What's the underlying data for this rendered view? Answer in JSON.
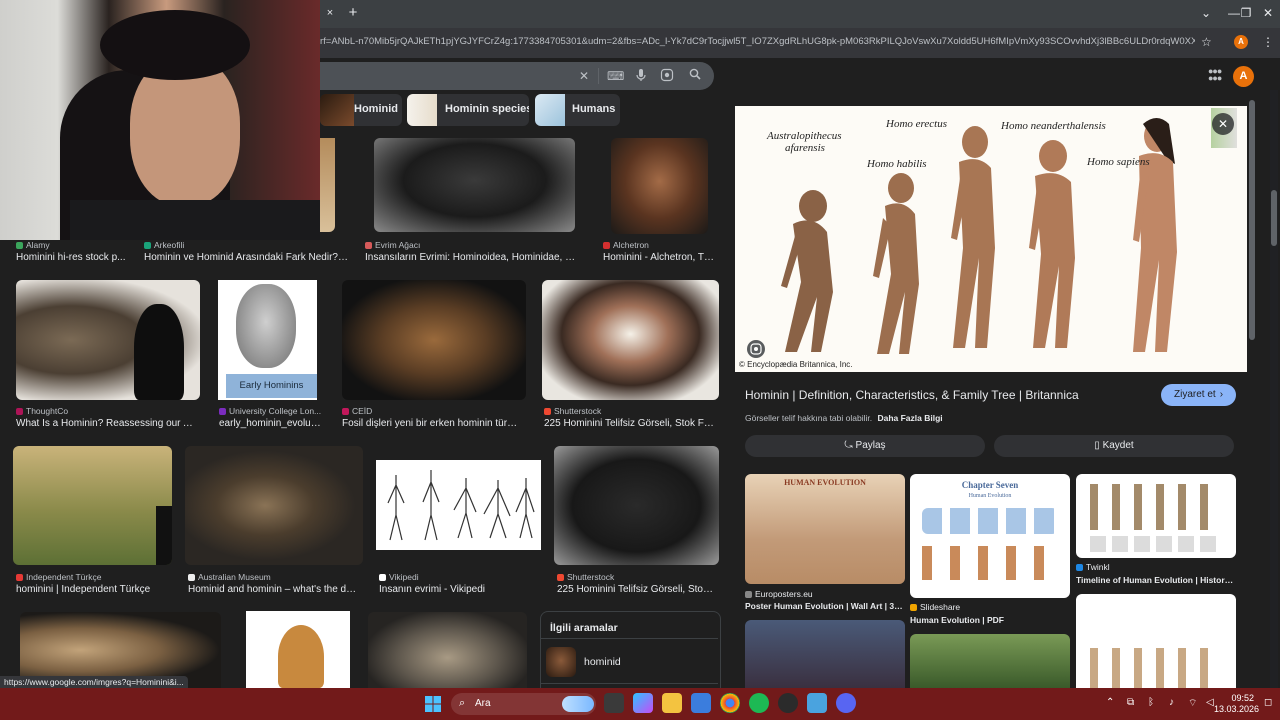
{
  "browser": {
    "tab_close": "×",
    "new_tab": "+",
    "window_controls": [
      "—",
      "❐",
      "✕"
    ],
    "url": "rf=ANbL-n70Mib5jrQAJkETh1pjYGJYFCrZ4g:1773384705301&udm=2&fbs=ADc_l-Yk7dC9rTocjjwl5T_IO7ZXgdRLhUG8pk-pM063RkPILQJoVswXu7Xoldd5UH6fMIpVmXy93SCOvvhdXj3lBBc6ULDr0rdqW0XXkPsl2-Ji...",
    "profile_initial": "A",
    "apps_icon": "⋮⋮⋮",
    "status_url": "https://www.google.com/imgres?q=Hominini&i..."
  },
  "search": {
    "clear": "✕",
    "icons": [
      "keyboard-icon",
      "mic-icon",
      "lens-icon",
      "search-icon"
    ]
  },
  "chips": [
    {
      "label": "Hominid"
    },
    {
      "label": "Hominin species"
    },
    {
      "label": "Humans"
    }
  ],
  "results": [
    {
      "source": "Alamy",
      "title": "Hominini hi-res stock p...",
      "color": "#3ba55c"
    },
    {
      "source": "Arkeofili",
      "title": "Hominin ve Hominid Arasındaki Fark Nedir? -...",
      "color": "#1aa37a"
    },
    {
      "source": "Evrim Ağacı",
      "title": "İnsansıların Evrimi: Hominoidea, Hominidae, Ho...",
      "color": "#d65a5a"
    },
    {
      "source": "Alchetron",
      "title": "Hominini - Alchetron, Th...",
      "color": "#d32f2f"
    },
    {
      "source": "ThoughtCo",
      "title": "What Is a Hominin? Reassessing our An...",
      "color": "#ad1457"
    },
    {
      "source": "University College Lon...",
      "title": "early_hominin_evoluti...",
      "color": "#7b2cbf",
      "overlay": "Early Hominins"
    },
    {
      "source": "CEİD",
      "title": "Fosil dişleri yeni bir erken hominin türün...",
      "color": "#c2185b"
    },
    {
      "source": "Shutterstock",
      "title": "225 Hominini Telifsiz Görseli, Stok Fot...",
      "color": "#ee4831"
    },
    {
      "source": "Independent Türkçe",
      "title": "hominini | Independent Türkçe",
      "color": "#e53935"
    },
    {
      "source": "Australian Museum",
      "title": "Hominid and hominin – what's the diff...",
      "color": "#eeeeee"
    },
    {
      "source": "Vikipedi",
      "title": "İnsanın evrimi - Vikipedi",
      "color": "#ffffff"
    },
    {
      "source": "Shutterstock",
      "title": "225 Hominini Telifsiz Görseli, Stok ...",
      "color": "#ee4831"
    }
  ],
  "related": {
    "heading": "İlgili aramalar",
    "item": "hominid"
  },
  "panel": {
    "species": [
      "Australopithecus",
      "afarensis",
      "Homo habilis",
      "Homo erectus",
      "Homo neanderthalensis",
      "Homo sapiens"
    ],
    "credit": "© Encyclopædia Britannica, Inc.",
    "title": "Hominin | Definition, Characteristics, & Family Tree | Britannica",
    "visit": "Ziyaret et",
    "copyright_note": "Görseller telif hakkına tabi olabilir.",
    "more_info": "Daha Fazla Bilgi",
    "share": "Paylaş",
    "save": "Kaydet",
    "close": "✕",
    "similar": [
      {
        "source": "Europosters.eu",
        "title": "Poster Human Evolution | Wall Art | 3+1...",
        "banner": "HUMAN EVOLUTION"
      },
      {
        "source": "Slideshare",
        "title": "Human Evolution | PDF",
        "banner": "Chapter Seven",
        "sub": "Human Evolution"
      },
      {
        "source": "Twinkl",
        "title": "Timeline of Human Evolution | History &..."
      }
    ]
  },
  "taskbar": {
    "search_label": "Ara",
    "time": "09:52",
    "date": "13.03.2026"
  }
}
